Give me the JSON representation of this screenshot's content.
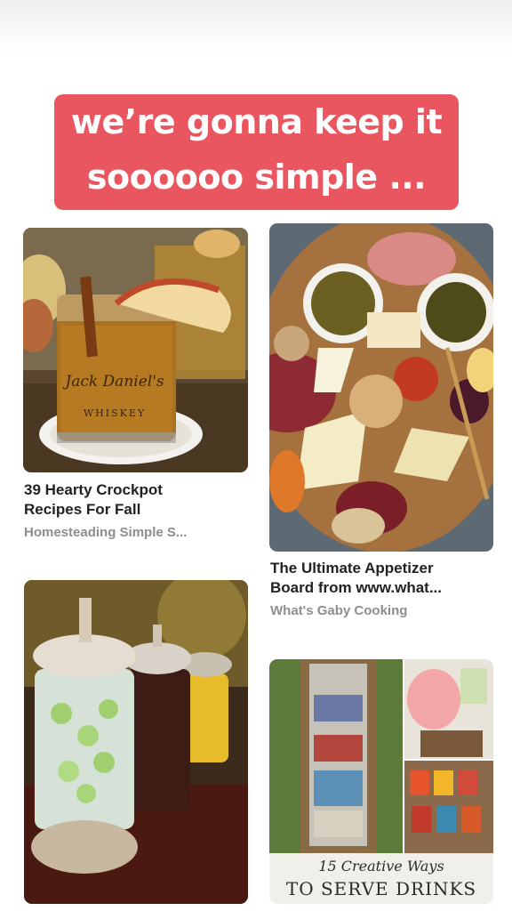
{
  "caption": {
    "line1": "we’re gonna keep it",
    "line2": "soooooo simple ..."
  },
  "pins": [
    {
      "title_line1": "39 Hearty Crockpot",
      "title_line2": "Recipes For Fall",
      "source": "Homesteading Simple S...",
      "image_text_1": "Jack Daniel's",
      "image_text_2": "WHISKEY"
    },
    {
      "title_line1": "The Ultimate Appetizer",
      "title_line2": "Board from www.what...",
      "source": "What's Gaby Cooking"
    },
    {
      "title_line1": "",
      "title_line2": "",
      "source": ""
    },
    {
      "image_text_1": "15 Creative Ways",
      "image_text_2": "TO SERVE DRINKS"
    }
  ],
  "colors": {
    "caption_bg": "#e9565f",
    "title": "#222222",
    "source": "#8e8e8e"
  }
}
